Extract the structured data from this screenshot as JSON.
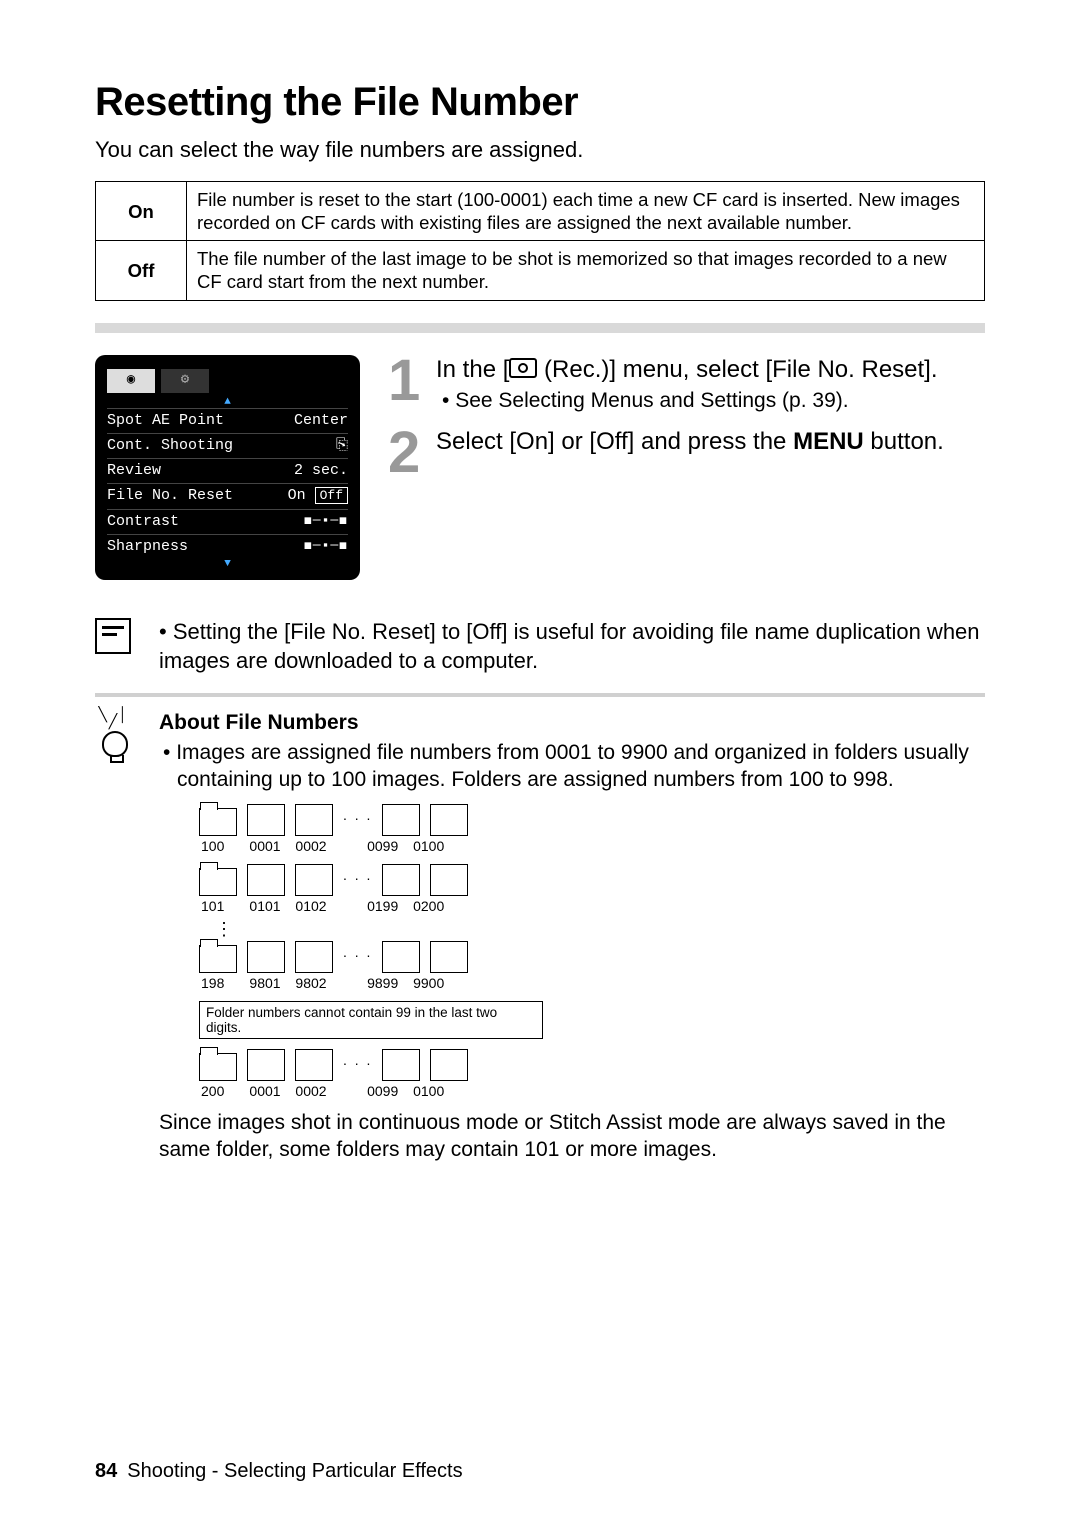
{
  "title": "Resetting the File Number",
  "intro": "You can select the way file numbers are assigned.",
  "options_table": [
    {
      "label": "On",
      "desc": "File number is reset to the start (100-0001) each time a new CF card is inserted. New images recorded on CF cards with existing files are assigned the next available number."
    },
    {
      "label": "Off",
      "desc": "The file number of the last image to be shot is memorized so that images recorded to a new CF card start from the next number."
    }
  ],
  "lcd_menu": {
    "rows": [
      {
        "name": "Spot AE Point",
        "value": "Center"
      },
      {
        "name": "Cont. Shooting",
        "value": "⎘"
      },
      {
        "name": "Review",
        "value": "2 sec."
      },
      {
        "name": "File No. Reset",
        "value": "On  Off",
        "highlighted": "Off"
      },
      {
        "name": "Contrast",
        "value": "◼─▪─◼"
      },
      {
        "name": "Sharpness",
        "value": "◼─▪─◼"
      }
    ]
  },
  "steps": [
    {
      "num": "1",
      "heading_pre": "In the [",
      "heading_post": " (Rec.)] menu, select [File No. Reset].",
      "sub": "See Selecting Menus and Settings (p. 39)."
    },
    {
      "num": "2",
      "heading": "Select [On] or [Off] and press the MENU button.",
      "sub": null
    }
  ],
  "note": "Setting the [File No. Reset] to [Off] is useful for avoiding file name duplication when images are downloaded to a computer.",
  "tip": {
    "heading": "About File Numbers",
    "p1": "Images are assigned file numbers from 0001 to 9900 and organized in folders usually containing up to 100 images. Folders are assigned numbers from 100 to 998.",
    "p2": "Since images shot in continuous mode or Stitch Assist mode are always saved in the same folder, some folders may contain 101 or more images."
  },
  "diagram": {
    "rows": [
      {
        "folder": "100",
        "files": [
          "0001",
          "0002",
          "0099",
          "0100"
        ]
      },
      {
        "folder": "101",
        "files": [
          "0101",
          "0102",
          "0199",
          "0200"
        ]
      },
      {
        "folder": "198",
        "files": [
          "9801",
          "9802",
          "9899",
          "9900"
        ]
      },
      {
        "folder": "200",
        "files": [
          "0001",
          "0002",
          "0099",
          "0100"
        ]
      }
    ],
    "note": "Folder numbers cannot contain 99 in the last two digits."
  },
  "footer": {
    "page": "84",
    "section": "Shooting - Selecting Particular Effects"
  }
}
